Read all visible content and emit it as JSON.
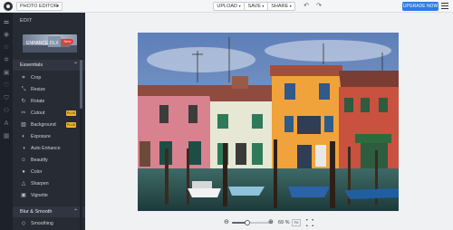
{
  "topbar": {
    "app_select": "PHOTO EDITOR",
    "upload_label": "UPLOAD",
    "save_label": "SAVE",
    "share_label": "SHARE",
    "upgrade_label": "UPGRADE NOW"
  },
  "panel": {
    "title": "EDIT",
    "enhance_card": {
      "label": "ENHANCE DLX",
      "badge": "New"
    },
    "essentials_header": "Essentials",
    "tools": [
      {
        "label": "Crop",
        "icon": "crop-icon"
      },
      {
        "label": "Resize",
        "icon": "resize-icon"
      },
      {
        "label": "Rotate",
        "icon": "rotate-icon"
      },
      {
        "label": "Cutout",
        "icon": "cutout-icon",
        "badge": "PLUS"
      },
      {
        "label": "Background",
        "icon": "background-icon",
        "badge": "PLUS"
      },
      {
        "label": "Exposure",
        "icon": "exposure-icon"
      },
      {
        "label": "Auto Enhance",
        "icon": "auto-enhance-icon"
      },
      {
        "label": "Beautify",
        "icon": "beautify-icon"
      },
      {
        "label": "Color",
        "icon": "color-icon"
      },
      {
        "label": "Sharpen",
        "icon": "sharpen-icon"
      },
      {
        "label": "Vignette",
        "icon": "vignette-icon"
      }
    ],
    "blur_header": "Blur & Smooth",
    "blur_tools": [
      {
        "label": "Smoothing",
        "icon": "smoothing-icon"
      }
    ]
  },
  "zoom": {
    "value_label": "69 %",
    "level": 0.69,
    "fit_label": "Fit"
  },
  "colors": {
    "accent": "#2c7be5",
    "panel_bg": "#262b34",
    "rail_bg": "#1d2129",
    "badge": "#f0b429"
  }
}
